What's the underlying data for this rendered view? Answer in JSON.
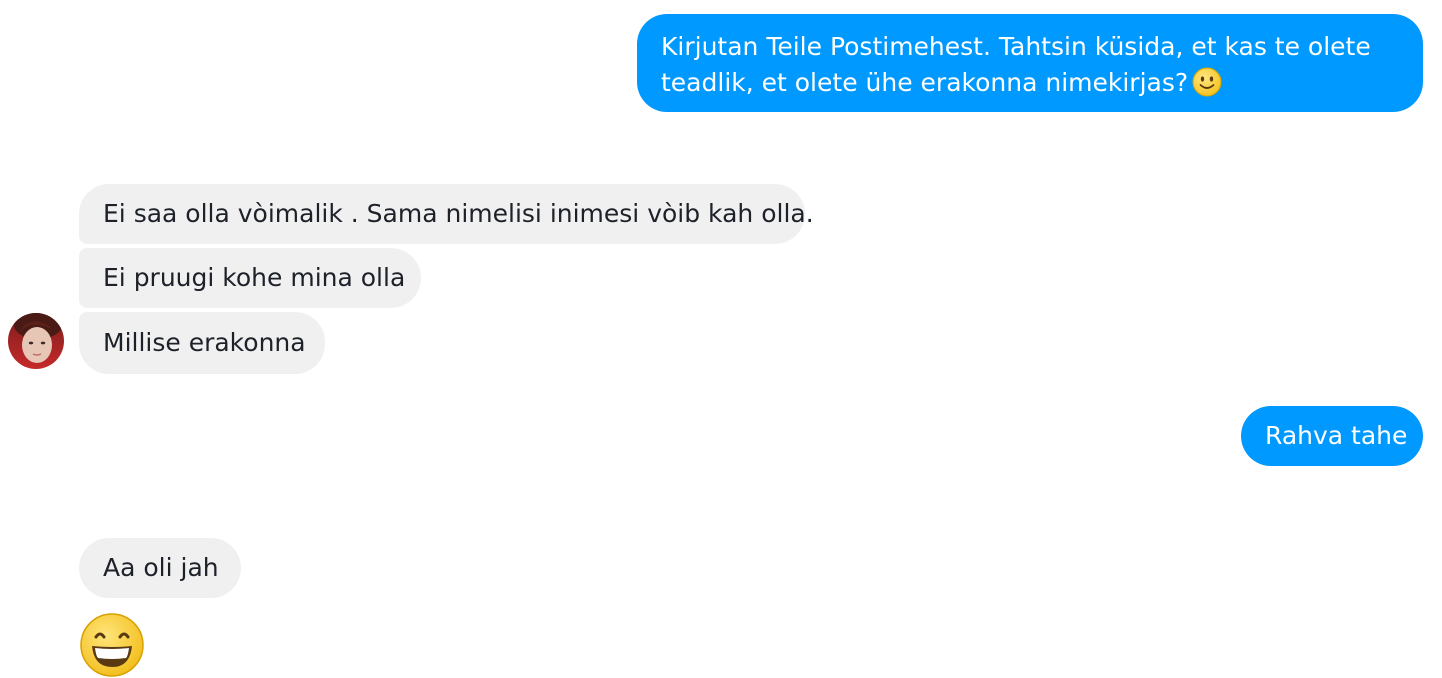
{
  "conversation": {
    "messages": [
      {
        "direction": "outgoing",
        "lines": [
          "Kirjutan Teile Postimehest. Tahtsin küsida, et kas te olete",
          "teadlik, et olete ühe erakonna nimekirjas?"
        ],
        "emoji": "slightly-smiling-face-icon"
      },
      {
        "direction": "incoming",
        "text": "Ei saa olla vòimalik . Sama nimelisi inimesi vòib kah olla."
      },
      {
        "direction": "incoming",
        "text": "Ei pruugi kohe mina olla"
      },
      {
        "direction": "incoming",
        "text": "Millise erakonna"
      },
      {
        "direction": "outgoing",
        "text": "Rahva tahe"
      },
      {
        "direction": "incoming",
        "text": "Aa oli jah"
      },
      {
        "direction": "incoming",
        "emoji": "grinning-face-icon"
      }
    ]
  },
  "colors": {
    "outgoing_bubble": "#0099ff",
    "incoming_bubble": "#f1f0f0",
    "incoming_text": "#1d2129",
    "outgoing_text": "#ffffff"
  }
}
